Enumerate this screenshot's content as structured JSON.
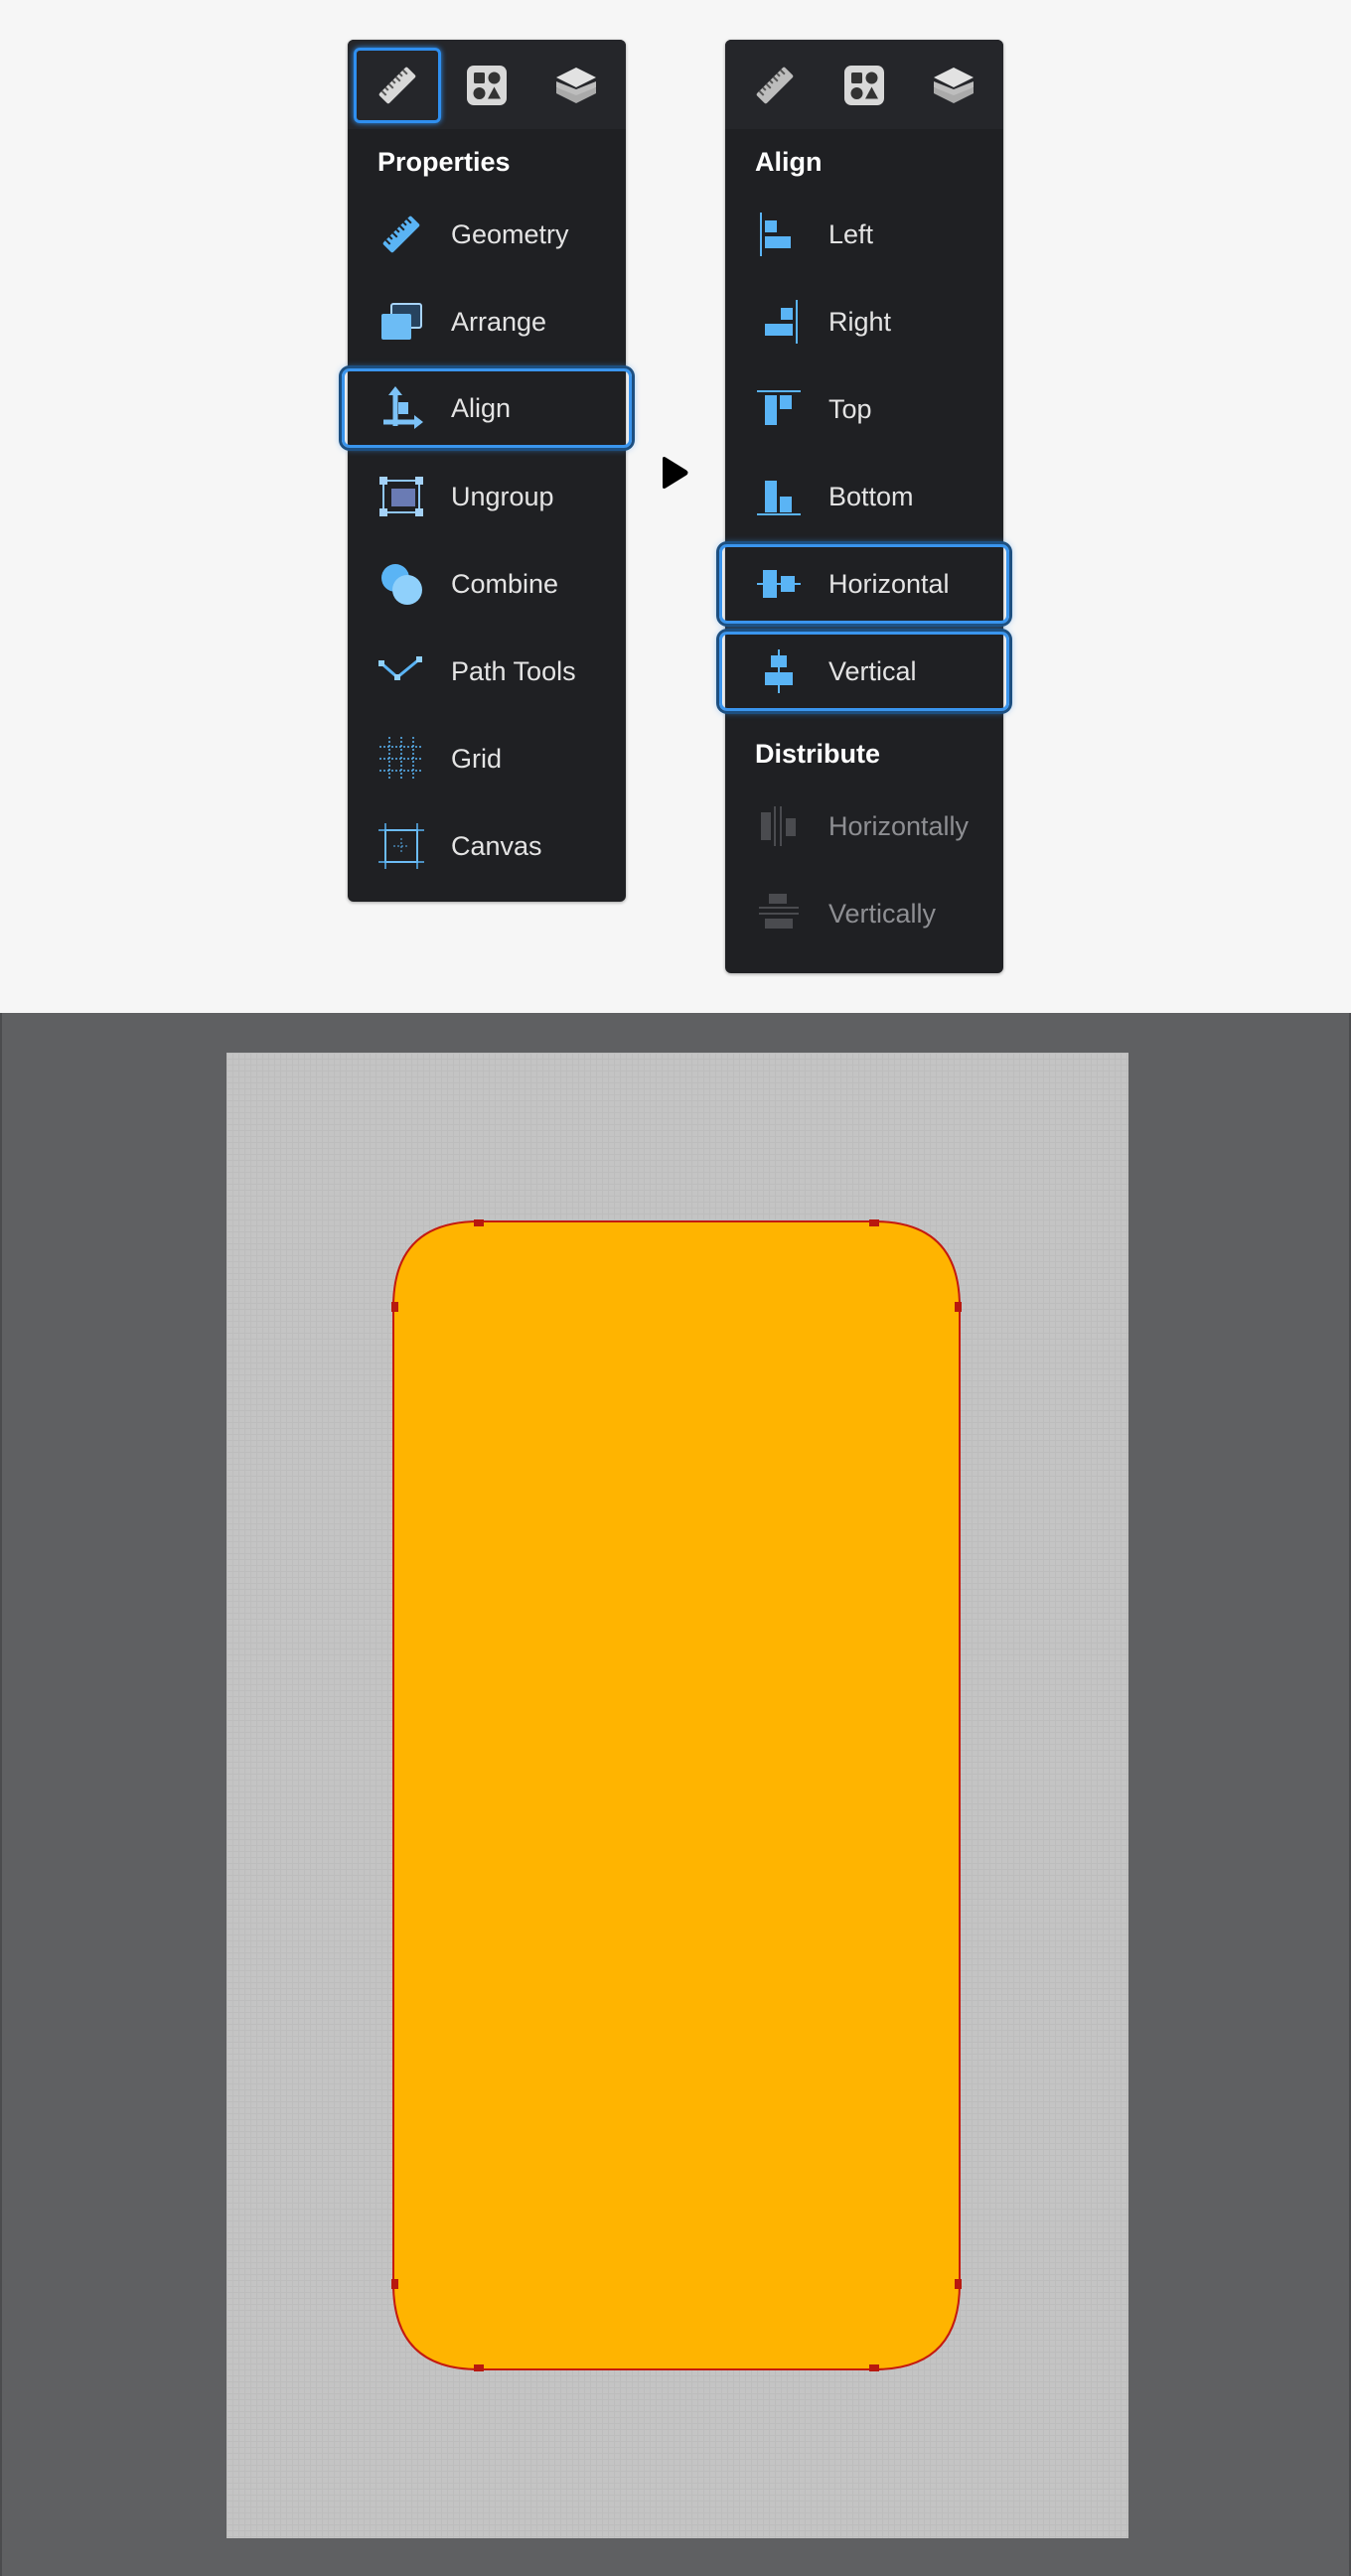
{
  "colors": {
    "panel_bg": "#1f2023",
    "accent": "#3a95ee",
    "icon_blue": "#5ab4f5",
    "shape_fill": "#ffb400",
    "shape_stroke": "#c41a10",
    "canvas_bg": "#5f6062",
    "artboard_bg": "#c4c4c4"
  },
  "left_panel": {
    "tabs": [
      {
        "icon": "ruler-icon",
        "active": true
      },
      {
        "icon": "shapes-icon",
        "active": false
      },
      {
        "icon": "layers-icon",
        "active": false
      }
    ],
    "section_title": "Properties",
    "items": [
      {
        "label": "Geometry",
        "icon": "ruler-icon"
      },
      {
        "label": "Arrange",
        "icon": "arrange-icon"
      },
      {
        "label": "Align",
        "icon": "align-icon",
        "selected": true
      },
      {
        "label": "Ungroup",
        "icon": "ungroup-icon"
      },
      {
        "label": "Combine",
        "icon": "combine-icon"
      },
      {
        "label": "Path Tools",
        "icon": "path-tools-icon"
      },
      {
        "label": "Grid",
        "icon": "grid-icon"
      },
      {
        "label": "Canvas",
        "icon": "canvas-icon"
      }
    ]
  },
  "right_panel": {
    "tabs": [
      {
        "icon": "ruler-icon",
        "active": false
      },
      {
        "icon": "shapes-icon",
        "active": false
      },
      {
        "icon": "layers-icon",
        "active": false
      }
    ],
    "align_title": "Align",
    "align_items": [
      {
        "label": "Left",
        "icon": "align-left-icon"
      },
      {
        "label": "Right",
        "icon": "align-right-icon"
      },
      {
        "label": "Top",
        "icon": "align-top-icon"
      },
      {
        "label": "Bottom",
        "icon": "align-bottom-icon"
      },
      {
        "label": "Horizontal",
        "icon": "align-horizontal-center-icon",
        "selected": true
      },
      {
        "label": "Vertical",
        "icon": "align-vertical-center-icon",
        "selected": true
      }
    ],
    "distribute_title": "Distribute",
    "distribute_items": [
      {
        "label": "Horizontally",
        "icon": "distribute-horizontal-icon",
        "disabled": true
      },
      {
        "label": "Vertically",
        "icon": "distribute-vertical-icon",
        "disabled": true
      }
    ]
  }
}
